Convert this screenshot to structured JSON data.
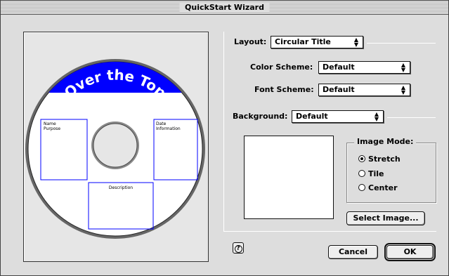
{
  "window": {
    "title": "QuickStart Wizard"
  },
  "preview": {
    "curved_title": "Over the Top",
    "box_left_lines": [
      "Name",
      "Purpose"
    ],
    "box_right_lines": [
      "Date",
      "Information"
    ],
    "box_bottom_label": "Description",
    "band_color": "#0000ff",
    "outline_color": "#0000ff"
  },
  "controls": {
    "layout": {
      "label": "Layout:",
      "value": "Circular Title"
    },
    "color_scheme": {
      "label": "Color Scheme:",
      "value": "Default"
    },
    "font_scheme": {
      "label": "Font Scheme:",
      "value": "Default"
    },
    "background": {
      "label": "Background:",
      "value": "Default"
    },
    "image_mode": {
      "label": "Image Mode:",
      "options": [
        {
          "label": "Stretch",
          "selected": true
        },
        {
          "label": "Tile",
          "selected": false
        },
        {
          "label": "Center",
          "selected": false
        }
      ]
    },
    "select_image_button": "Select Image...",
    "cancel_button": "Cancel",
    "ok_button": "OK",
    "help_icon": "help-icon"
  }
}
